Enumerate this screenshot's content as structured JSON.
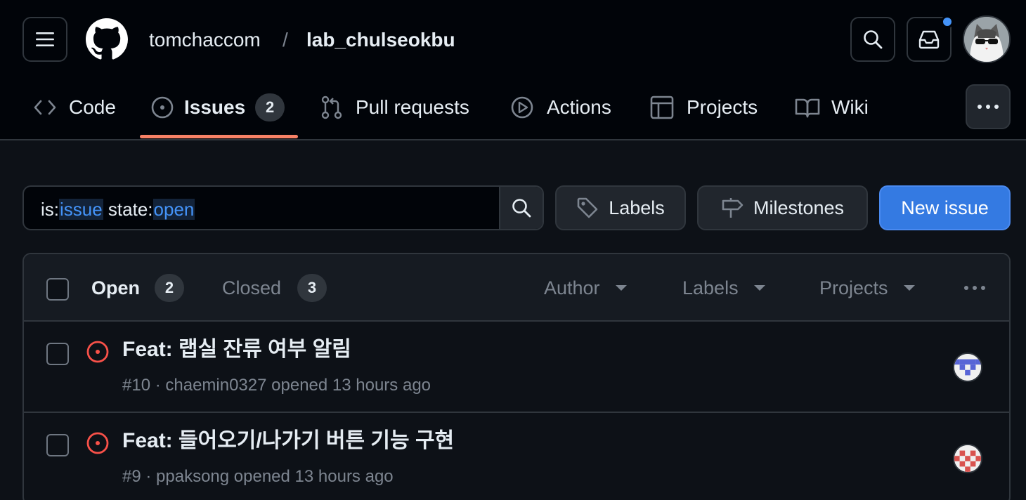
{
  "header": {
    "owner": "tomchaccom",
    "separator": "/",
    "repo": "lab_chulseokbu"
  },
  "nav": {
    "code": "Code",
    "issues": "Issues",
    "issues_count": "2",
    "pull_requests": "Pull requests",
    "actions": "Actions",
    "projects": "Projects",
    "wiki": "Wiki"
  },
  "filter": {
    "prefix1": "is:",
    "value1": "issue",
    "prefix2": " state:",
    "value2": "open"
  },
  "buttons": {
    "labels": "Labels",
    "milestones": "Milestones",
    "new_issue": "New issue"
  },
  "list_header": {
    "open_label": "Open",
    "open_count": "2",
    "closed_label": "Closed",
    "closed_count": "3",
    "author": "Author",
    "labels": "Labels",
    "projects": "Projects"
  },
  "issues": [
    {
      "title": "Feat: 랩실 잔류 여부 알림",
      "meta": "#10 · chaemin0327 opened 13 hours ago"
    },
    {
      "title": "Feat: 들어오기/나가기 버튼 기능 구현",
      "meta": "#9 · ppaksong opened 13 hours ago"
    }
  ],
  "colors": {
    "accent_blue": "#347ae2",
    "open_issue": "#f85149",
    "active_tab": "#f78166"
  }
}
